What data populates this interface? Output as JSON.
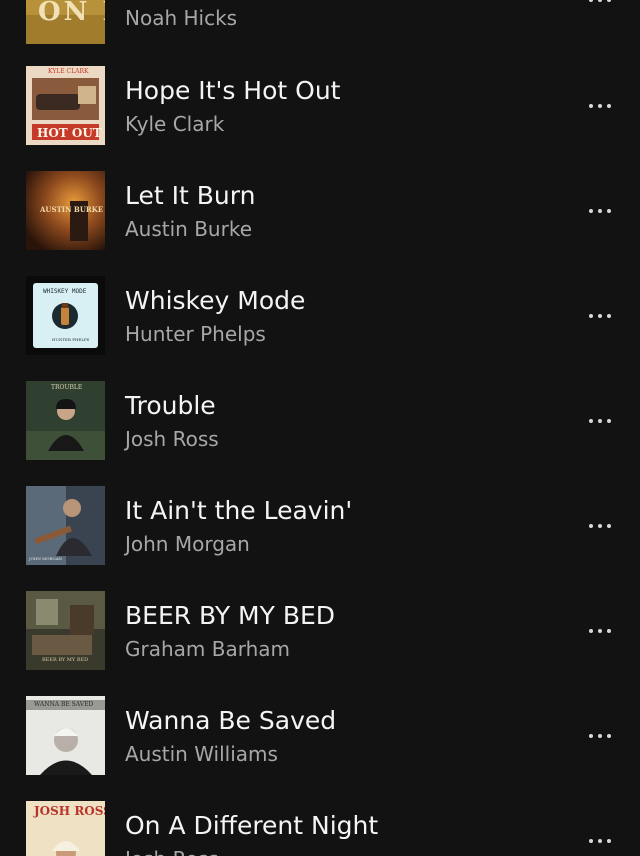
{
  "tracks": [
    {
      "title": "",
      "artist": "Noah Hicks",
      "art_icon": "album-art-gold",
      "art_text": "ON IT"
    },
    {
      "title": "Hope It's Hot Out",
      "artist": "Kyle Clark",
      "art_icon": "album-art-car",
      "art_text": "HOT OUT",
      "art_top": "KYLE CLARK"
    },
    {
      "title": "Let It Burn",
      "artist": "Austin Burke",
      "art_icon": "album-art-fire",
      "art_text": "AUSTIN BURKE"
    },
    {
      "title": "Whiskey Mode",
      "artist": "Hunter Phelps",
      "art_icon": "album-art-whiskey",
      "art_text": "WHISKEY MODE",
      "art_bottom": "HUNTER PHELPS"
    },
    {
      "title": "Trouble",
      "artist": "Josh Ross",
      "art_icon": "album-art-portrait",
      "art_text": "TROUBLE"
    },
    {
      "title": "It Ain't the Leavin'",
      "artist": "John Morgan",
      "art_icon": "album-art-guitar",
      "art_text": "JOHN MORGAN"
    },
    {
      "title": "BEER BY MY BED",
      "artist": "Graham Barham",
      "art_icon": "album-art-room",
      "art_text": "BEER BY MY BED"
    },
    {
      "title": "Wanna Be Saved",
      "artist": "Austin Williams",
      "art_icon": "album-art-bw-portrait",
      "art_text": "WANNA BE SAVED"
    },
    {
      "title": "On A Different Night",
      "artist": "Josh Ross",
      "art_icon": "album-art-cream",
      "art_text": "JOSH ROSS"
    }
  ],
  "colors": {
    "background": "#121212",
    "title": "#f4f4f4",
    "artist": "#a7a7a7",
    "more_dots": "#d8d8d8"
  }
}
